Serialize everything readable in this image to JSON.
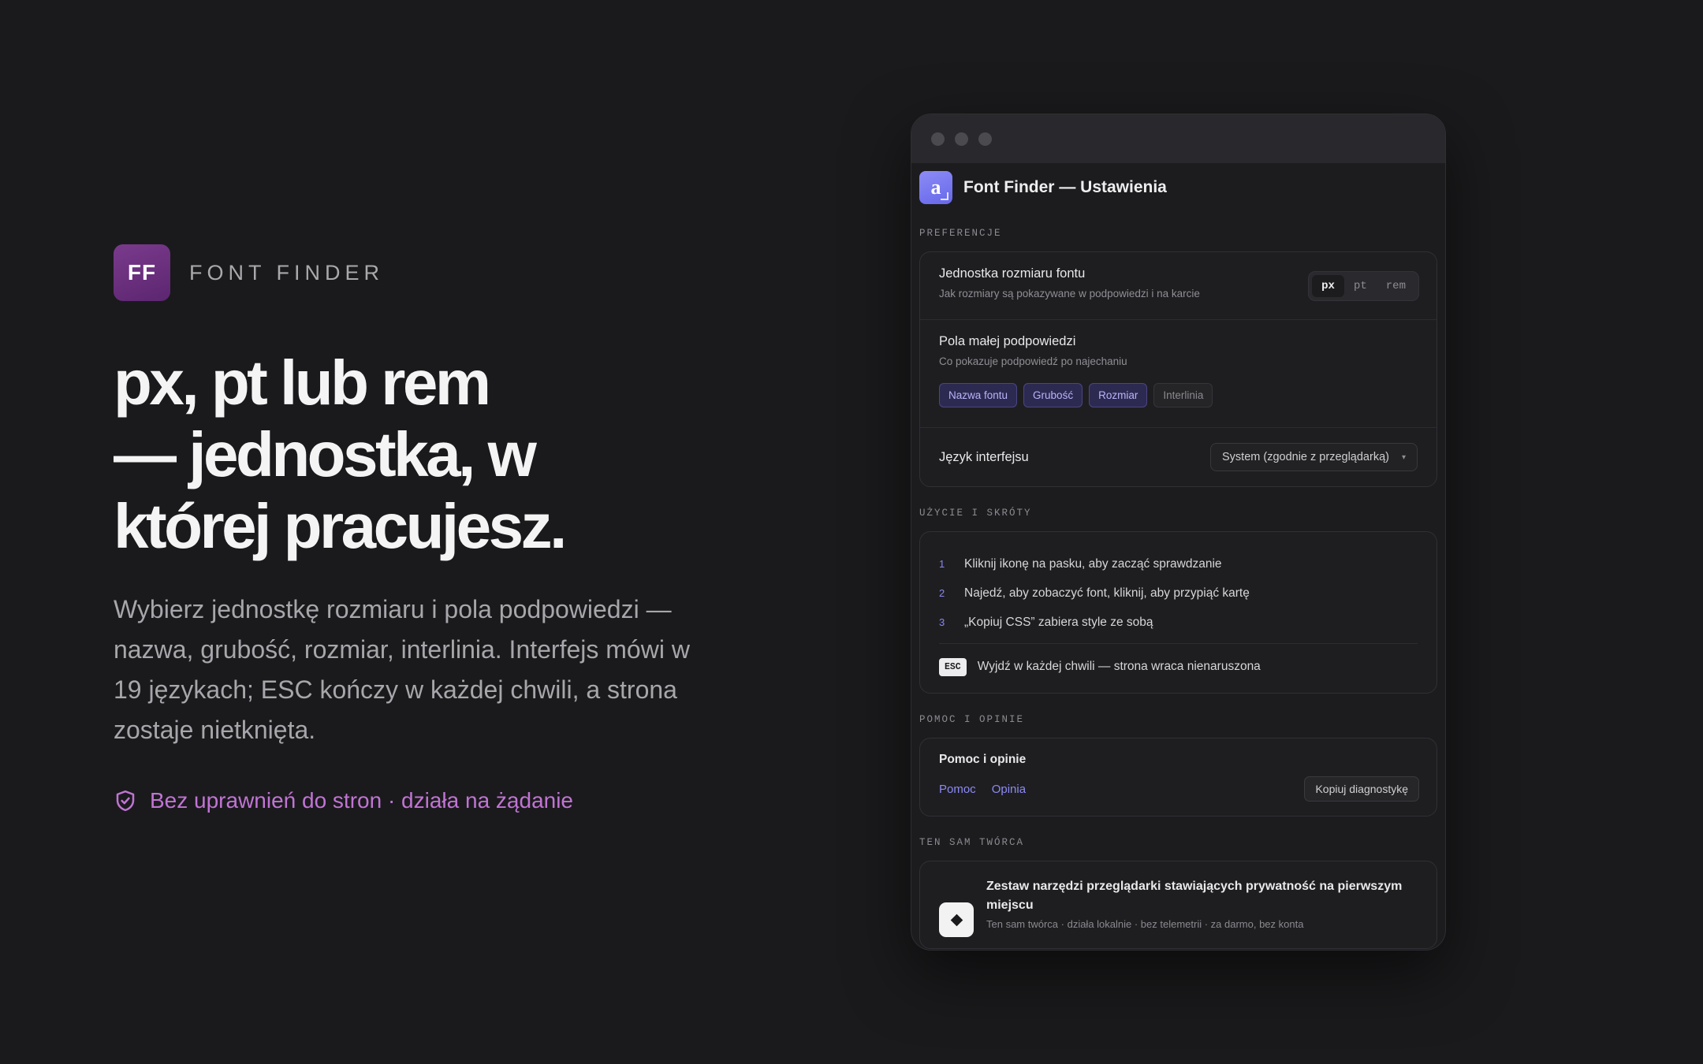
{
  "hero": {
    "brand_logo": "FF",
    "brand_name": "FONT FINDER",
    "title_lines": [
      "px, pt lub rem",
      "— jednostka, w",
      "której pracujesz."
    ],
    "description": "Wybierz jednostkę rozmiaru i pola podpowiedzi — nazwa, grubość, rozmiar, interlinia. Interfejs mówi w 19 językach; ESC kończy w każdej chwili, a strona zostaje nietknięta.",
    "badge_icon": "shield-check-icon",
    "badge_text": "Bez uprawnień do stron · działa na żądanie",
    "badge_color": "#c174d4"
  },
  "window": {
    "app_icon_letter": "a",
    "app_title": "Font Finder — Ustawienia",
    "sections": {
      "preferences": "PREFERENCJE",
      "usage": "UŻYCIE I SKRÓTY",
      "help": "POMOC I OPINIE",
      "creator": "TEN SAM TWÓRCA"
    },
    "font_unit": {
      "title": "Jednostka rozmiaru fontu",
      "subtitle": "Jak rozmiary są pokazywane w podpowiedzi i na karcie",
      "options": [
        "px",
        "pt",
        "rem"
      ],
      "selected": "px"
    },
    "tooltip_fields": {
      "title": "Pola małej podpowiedzi",
      "subtitle": "Co pokazuje podpowiedź po najechaniu",
      "chips": [
        {
          "label": "Nazwa fontu",
          "active": true
        },
        {
          "label": "Grubość",
          "active": true
        },
        {
          "label": "Rozmiar",
          "active": true
        },
        {
          "label": "Interlinia",
          "active": false
        }
      ]
    },
    "language": {
      "title": "Język interfejsu",
      "value": "System (zgodnie z przeglądarką)"
    },
    "steps": [
      {
        "num": "1",
        "text": "Kliknij ikonę na pasku, aby zacząć sprawdzanie"
      },
      {
        "num": "2",
        "text": "Najedź, aby zobaczyć font, kliknij, aby przypiąć kartę"
      },
      {
        "num": "3",
        "text": "„Kopiuj CSS” zabiera style ze sobą"
      }
    ],
    "esc": {
      "key": "ESC",
      "text": "Wyjdź w każdej chwili — strona wraca nienaruszona"
    },
    "help": {
      "title": "Pomoc i opinie",
      "link_help": "Pomoc",
      "link_feedback": "Opinia",
      "copy_button": "Kopiuj diagnostykę"
    },
    "creator": {
      "title": "Zestaw narzędzi przeglądarki stawiających prywatność na pierwszym miejscu",
      "subtitle": "Ten sam twórca · działa lokalnie · bez telemetrii · za darmo, bez konta"
    },
    "accent": "#8c8af4"
  }
}
